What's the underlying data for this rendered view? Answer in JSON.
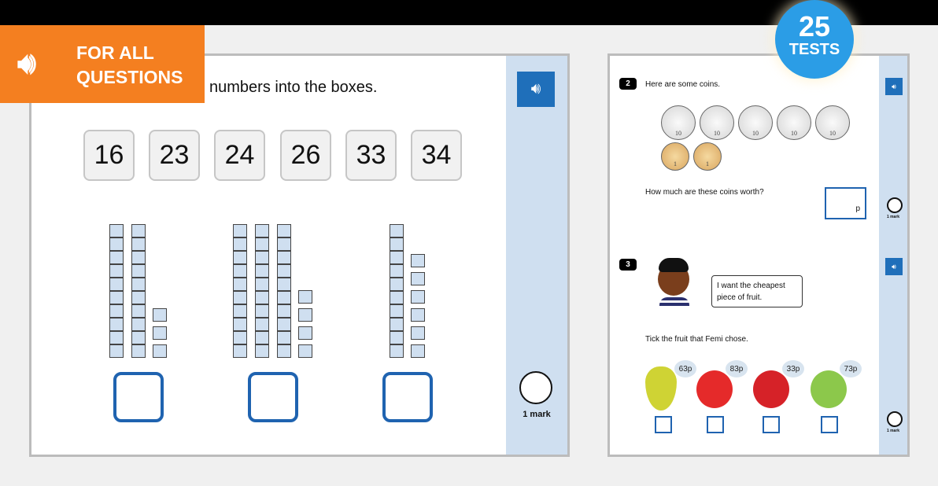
{
  "banner": {
    "line1": "FOR ALL",
    "line2": "QUESTIONS",
    "icon": "speaker-icon",
    "color": "#f47f20"
  },
  "badge": {
    "number": "25",
    "label": "TESTS",
    "color": "#2b9de6"
  },
  "left": {
    "prompt": "numbers into the boxes.",
    "tiles": [
      "16",
      "23",
      "24",
      "26",
      "33",
      "34"
    ],
    "blocks": [
      {
        "tens": 2,
        "ones": 3
      },
      {
        "tens": 3,
        "ones": 4
      },
      {
        "tens": 1,
        "ones": 6
      }
    ],
    "mark": "1 mark"
  },
  "right": {
    "q2": {
      "number": "2",
      "text": "Here are some coins.",
      "coins": [
        "10",
        "10",
        "10",
        "10",
        "10",
        "1",
        "1"
      ],
      "question": "How much are these coins worth?",
      "unit": "p",
      "mark": "1 mark"
    },
    "q3": {
      "number": "3",
      "speech": "I want the cheapest piece of fruit.",
      "question": "Tick the fruit that Femi chose.",
      "fruits": [
        {
          "name": "pear",
          "price": "63p",
          "color": "#cfd334"
        },
        {
          "name": "tomato",
          "price": "83p",
          "color": "#e52a2a"
        },
        {
          "name": "red apple",
          "price": "33p",
          "color": "#d62228"
        },
        {
          "name": "green apple",
          "price": "73p",
          "color": "#8cc84b"
        }
      ],
      "mark": "1 mark"
    }
  },
  "colors": {
    "accent": "#1f63b0",
    "sidebar": "#cfdff0"
  }
}
